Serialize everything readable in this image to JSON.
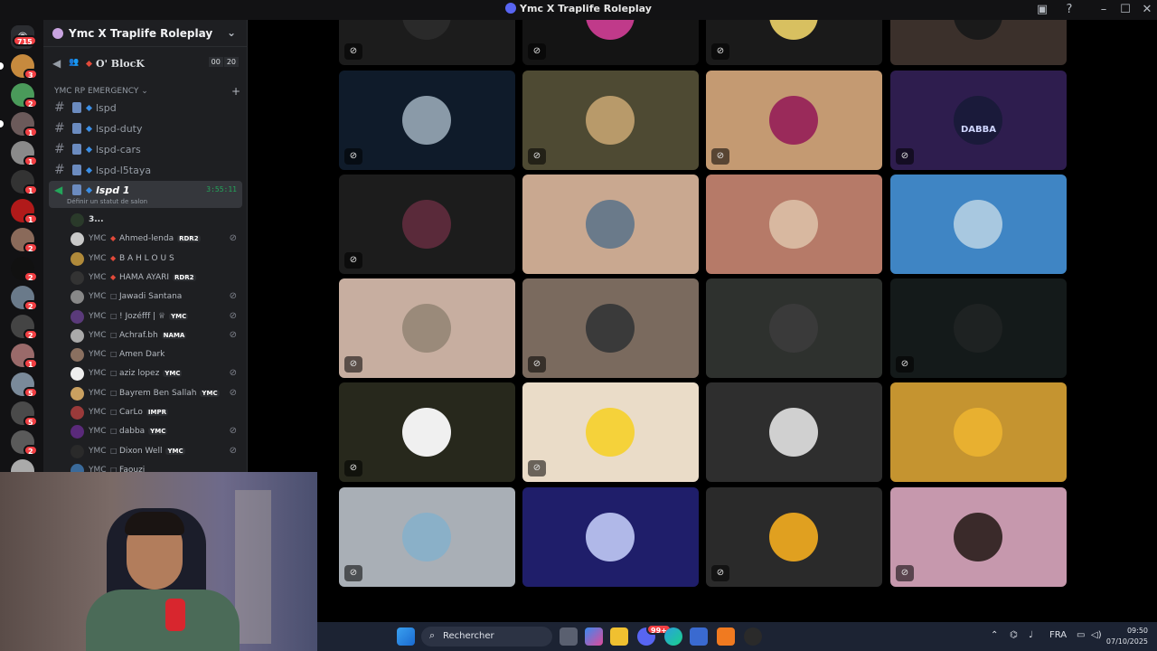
{
  "window": {
    "title": "Ymc X Traplife Roleplay",
    "inbox_icon": "inbox-icon",
    "help_icon": "help-icon"
  },
  "server_rail": {
    "home_badge": "715",
    "servers": [
      {
        "badge": "3",
        "color": "#c68a3e"
      },
      {
        "badge": "2",
        "color": "#4a9a5a"
      },
      {
        "badge": "1",
        "color": "#6b5a5a"
      },
      {
        "badge": "1",
        "color": "#8a8a8a"
      },
      {
        "badge": "1",
        "color": "#333333"
      },
      {
        "badge": "1",
        "color": "#b11a1a"
      },
      {
        "badge": "2",
        "color": "#8a6a5a"
      },
      {
        "badge": "2",
        "color": "#111111"
      },
      {
        "badge": "2",
        "color": "#6a7a8a"
      },
      {
        "badge": "2",
        "color": "#444444"
      },
      {
        "badge": "1",
        "color": "#9a6a6a"
      },
      {
        "badge": "5",
        "color": "#7a8a9a"
      },
      {
        "badge": "5",
        "color": "#4a4a4a"
      },
      {
        "badge": "2",
        "color": "#5a5a5a"
      },
      {
        "badge": "",
        "color": "#aaaaaa"
      }
    ]
  },
  "sidebar": {
    "server_name": "Ymc X Traplife Roleplay",
    "voice_top": {
      "name": "O' BlocK",
      "count_current": "00",
      "count_limit": "20"
    },
    "category": "YMC RP EMERGENCY",
    "channels": [
      {
        "name": "lspd"
      },
      {
        "name": "lspd-duty"
      },
      {
        "name": "lspd-cars"
      },
      {
        "name": "lspd-l5taya"
      }
    ],
    "active_voice": {
      "name": "lspd 1",
      "timer": "3:55:11",
      "status": "Définir un statut de salon"
    },
    "members": [
      {
        "tag": "",
        "name": "3...",
        "badge": "",
        "muted": false,
        "color": "#2a3a2a"
      },
      {
        "tag": "YMC",
        "name": "Ahmed-lenda",
        "badge": "RDR2",
        "muted": true,
        "color": "#c9c9c9"
      },
      {
        "tag": "YMC",
        "name": "B A H L O U S",
        "badge": "",
        "muted": false,
        "color": "#b08a3a"
      },
      {
        "tag": "YMC",
        "name": "HAMA AYARI",
        "badge": "RDR2",
        "muted": false,
        "color": "#333333"
      },
      {
        "tag": "YMC",
        "name": "Jawadi Santana",
        "badge": "",
        "muted": true,
        "color": "#888888"
      },
      {
        "tag": "YMC",
        "name": "! Jozéfff | ♕",
        "badge": "YMC",
        "muted": true,
        "color": "#5a3a7a"
      },
      {
        "tag": "YMC",
        "name": "Achraf.bh",
        "badge": "NAMA",
        "muted": true,
        "color": "#aaaaaa"
      },
      {
        "tag": "YMC",
        "name": "Amen Dark",
        "badge": "",
        "muted": false,
        "color": "#8a7060"
      },
      {
        "tag": "YMC",
        "name": "aziz lopez",
        "badge": "YMC",
        "muted": true,
        "color": "#eeeeee"
      },
      {
        "tag": "YMC",
        "name": "Bayrem Ben Sallah",
        "badge": "YMC",
        "muted": true,
        "color": "#c9a060"
      },
      {
        "tag": "YMC",
        "name": "CarLo",
        "badge": "IMPR",
        "muted": false,
        "color": "#9a3a3a"
      },
      {
        "tag": "YMC",
        "name": "dabba",
        "badge": "YMC",
        "muted": true,
        "color": "#5a2a7a"
      },
      {
        "tag": "YMC",
        "name": "Dixon Well",
        "badge": "YMC",
        "muted": true,
        "color": "#2a2a2a"
      },
      {
        "tag": "YMC",
        "name": "Faouzi",
        "badge": "",
        "muted": false,
        "color": "#3a6a9a"
      }
    ]
  },
  "tiles": [
    {
      "bg": "#1c1c1c",
      "avatar": "#2a2a2a",
      "muted": true,
      "label": ""
    },
    {
      "bg": "#141414",
      "avatar": "#c03a8a",
      "muted": true,
      "label": ""
    },
    {
      "bg": "#1a1a1a",
      "avatar": "#d8c060",
      "muted": true,
      "label": ""
    },
    {
      "bg": "#3b302b",
      "avatar": "#1a1a1a",
      "muted": false,
      "label": ""
    },
    {
      "bg": "#0f1b2a",
      "avatar": "#8a9aa8",
      "muted": true,
      "label": ""
    },
    {
      "bg": "#4e4a33",
      "avatar": "#b89a6a",
      "muted": true,
      "label": ""
    },
    {
      "bg": "#c49a72",
      "avatar": "#9a2a5a",
      "muted": true,
      "label": ""
    },
    {
      "bg": "#2e1d4e",
      "avatar": "#1a1a3a",
      "muted": true,
      "label": "DABBA"
    },
    {
      "bg": "#1c1c1c",
      "avatar": "#5a2a3a",
      "muted": true,
      "label": ""
    },
    {
      "bg": "#c9a890",
      "avatar": "#6a7a8a",
      "muted": false,
      "label": ""
    },
    {
      "bg": "#b67a68",
      "avatar": "#d8b8a0",
      "muted": false,
      "label": ""
    },
    {
      "bg": "#3f85c4",
      "avatar": "#a8c8e0",
      "muted": false,
      "label": ""
    },
    {
      "bg": "#c7aea0",
      "avatar": "#9a8a7a",
      "muted": true,
      "label": ""
    },
    {
      "bg": "#7a6a5e",
      "avatar": "#3a3a3a",
      "muted": true,
      "label": ""
    },
    {
      "bg": "#2e312e",
      "avatar": "#3a3a3a",
      "muted": false,
      "label": ""
    },
    {
      "bg": "#141a1a",
      "avatar": "#1e2222",
      "muted": true,
      "label": ""
    },
    {
      "bg": "#27281c",
      "avatar": "#f0f0f0",
      "muted": true,
      "label": ""
    },
    {
      "bg": "#eadcc8",
      "avatar": "#f5d23a",
      "muted": true,
      "label": ""
    },
    {
      "bg": "#2e2e2e",
      "avatar": "#d0d0d0",
      "muted": false,
      "label": ""
    },
    {
      "bg": "#c59430",
      "avatar": "#e8b030",
      "muted": false,
      "label": ""
    },
    {
      "bg": "#a9afb6",
      "avatar": "#8ab0c8",
      "muted": true,
      "label": ""
    },
    {
      "bg": "#1f1e6a",
      "avatar": "#b0b8e8",
      "muted": false,
      "label": ""
    },
    {
      "bg": "#2a2a2a",
      "avatar": "#e0a020",
      "muted": true,
      "label": ""
    },
    {
      "bg": "#c698ad",
      "avatar": "#3a2a2a",
      "muted": true,
      "label": ""
    }
  ],
  "taskbar": {
    "search_placeholder": "Rechercher",
    "language": "FRA",
    "time": "09:50",
    "date": "07/10/2025",
    "discord_badge": "99+"
  }
}
